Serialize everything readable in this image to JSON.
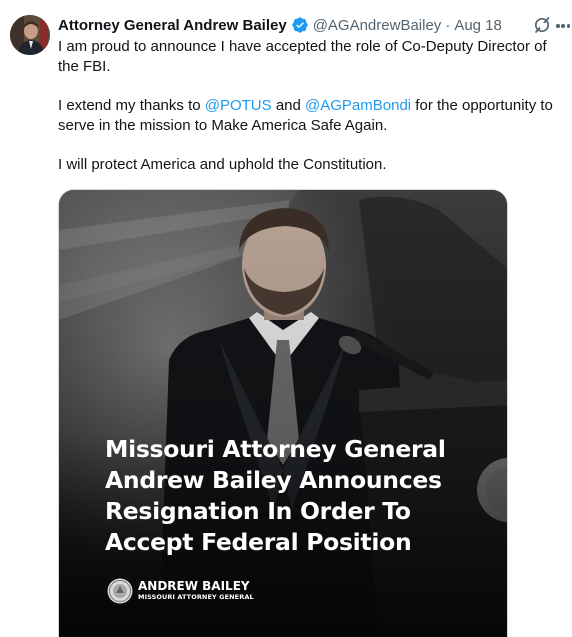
{
  "tweet": {
    "author_name": "Attorney General Andrew Bailey",
    "handle": "@AGAndrewBailey",
    "separator": "·",
    "date": "Aug 18",
    "paragraphs": {
      "p1": "I am proud to announce I have accepted the role of Co-Deputy Director of the FBI.",
      "p2_before": "I extend my thanks to ",
      "p2_mention1": "@POTUS",
      "p2_middle": " and ",
      "p2_mention2": "@AGPamBondi",
      "p2_after": " for the opportunity to serve in the mission to Make America Safe Again.",
      "p3": "I will protect America and uphold the Constitution."
    },
    "icons": {
      "verified": "verified-badge-icon",
      "grok": "grok-icon",
      "more": "more-icon"
    }
  },
  "media": {
    "headline_lines": [
      "Missouri Attorney General",
      "Andrew Bailey Announces",
      "Resignation In Order To",
      "Accept Federal Position"
    ],
    "brand_name": "ANDREW BAILEY",
    "brand_title": "MISSOURI ATTORNEY GENERAL"
  },
  "colors": {
    "accent": "#1d9bf0",
    "text_primary": "#0f1419",
    "text_secondary": "#536471",
    "verified": "#1d9bf0"
  }
}
